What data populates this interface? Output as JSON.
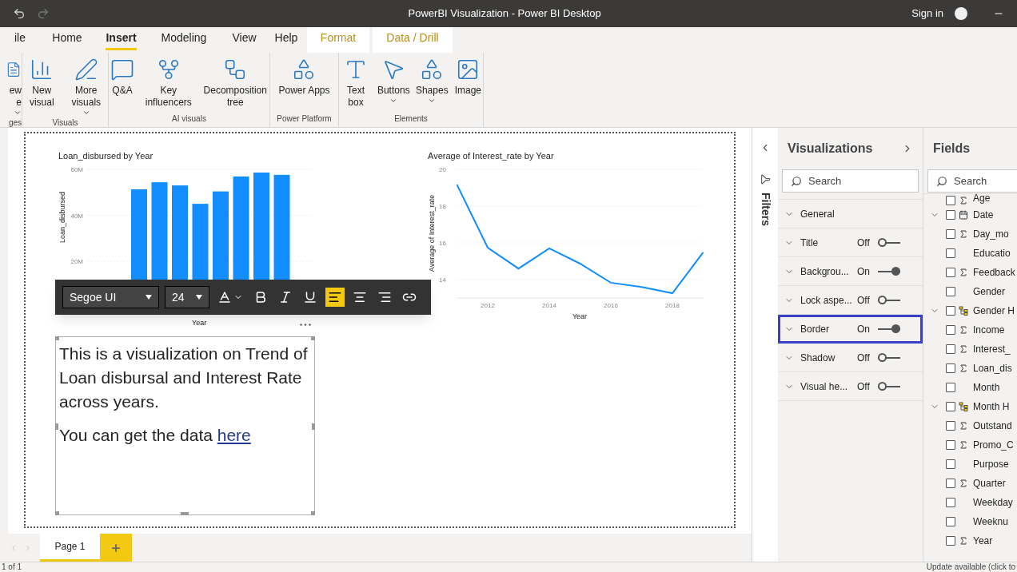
{
  "window": {
    "title": "PowerBI Visualization - Power BI Desktop",
    "sign_in": "Sign in"
  },
  "ribbon_tabs": [
    {
      "label": "ile",
      "kind": "normal",
      "selected": false
    },
    {
      "label": "Home",
      "kind": "normal",
      "selected": false
    },
    {
      "label": "Insert",
      "kind": "normal",
      "selected": true
    },
    {
      "label": "Modeling",
      "kind": "normal",
      "selected": false
    },
    {
      "label": "View",
      "kind": "normal",
      "selected": false
    },
    {
      "label": "Help",
      "kind": "normal",
      "selected": false
    },
    {
      "label": "Format",
      "kind": "contextual",
      "selected": false
    },
    {
      "label": "Data / Drill",
      "kind": "contextual",
      "selected": false
    }
  ],
  "ribbon_groups": [
    {
      "label": "ges",
      "items": [
        {
          "label": "ew e",
          "dropdown": true
        }
      ]
    },
    {
      "label": "Visuals",
      "items": [
        {
          "label": "New visual",
          "dropdown": false
        },
        {
          "label": "More visuals",
          "dropdown": true
        }
      ]
    },
    {
      "label": "AI visuals",
      "items": [
        {
          "label": "Q&A",
          "dropdown": false
        },
        {
          "label": "Key influencers",
          "dropdown": false
        },
        {
          "label": "Decomposition tree",
          "dropdown": false
        }
      ]
    },
    {
      "label": "Power Platform",
      "items": [
        {
          "label": "Power Apps",
          "dropdown": false
        }
      ]
    },
    {
      "label": "Elements",
      "items": [
        {
          "label": "Text box",
          "dropdown": false
        },
        {
          "label": "Buttons",
          "dropdown": true
        },
        {
          "label": "Shapes",
          "dropdown": true
        },
        {
          "label": "Image",
          "dropdown": false
        }
      ]
    }
  ],
  "bar_visual": {
    "x_axis_title": "Year",
    "chart_data": {
      "type": "bar",
      "title": "Loan_disbursed by Year",
      "ylabel": "Loan_disbursed",
      "categories": [
        null,
        null,
        null,
        null,
        null,
        null,
        null,
        null,
        null,
        null,
        null
      ],
      "grid": true,
      "ylim": [
        0,
        60
      ],
      "series": [
        {
          "color": "#118dff",
          "values": [
            null,
            null,
            51.3,
            54.4,
            53.0,
            45.0,
            50.4,
            56.9,
            58.6,
            57.6,
            null
          ]
        }
      ],
      "yticks": [
        {
          "value": 20,
          "label": "20M"
        },
        {
          "value": 40,
          "label": "40M"
        },
        {
          "value": 60,
          "label": "60M"
        }
      ]
    }
  },
  "line_visual": {
    "chart_data": {
      "type": "line",
      "title": "Average of Interest_rate by Year",
      "xlabel": "Year",
      "ylabel": "Average of Interest_rate",
      "x": [
        2011,
        2012,
        2013,
        2014,
        2015,
        2016,
        2017,
        2018,
        2019
      ],
      "grid": true,
      "series": [
        {
          "color": "#118dff",
          "values": [
            19.17,
            15.74,
            14.6,
            15.7,
            14.87,
            13.83,
            13.6,
            13.26,
            15.48
          ]
        }
      ],
      "xlim": [
        2011,
        2019
      ],
      "ylim": [
        13,
        20
      ],
      "yticks": [
        14,
        16,
        18,
        20
      ],
      "xticks": [
        2012,
        2014,
        2016,
        2018
      ]
    }
  },
  "text_toolbar": {
    "font": "Segoe UI",
    "size": "24",
    "buttons": [
      {
        "kind": "font-color",
        "selected": false
      },
      {
        "kind": "bold",
        "selected": false
      },
      {
        "kind": "italic",
        "selected": false
      },
      {
        "kind": "underline",
        "selected": false
      },
      {
        "kind": "align-left",
        "selected": true
      },
      {
        "kind": "align-center",
        "selected": false
      },
      {
        "kind": "align-right",
        "selected": false
      },
      {
        "kind": "link",
        "selected": false
      }
    ]
  },
  "text_box": {
    "paragraphs": [
      {
        "text": "This is a visualization on Trend of Loan disbursal and Interest Rate across years."
      },
      {
        "text": "You can get the data",
        "link": "here"
      }
    ]
  },
  "filters_pane": {
    "title": "Filters"
  },
  "visualizations_pane": {
    "title": "Visualizations",
    "search": {
      "placeholder": "Search"
    },
    "sections": [
      {
        "label": "General",
        "kind": "plain",
        "highlighted": false
      },
      {
        "label": "Title",
        "kind": "toggle",
        "status": "Off",
        "on": false,
        "highlighted": false
      },
      {
        "label": "Backgrou...",
        "kind": "toggle",
        "status": "On",
        "on": true,
        "highlighted": false
      },
      {
        "label": "Lock aspe...",
        "kind": "toggle",
        "status": "Off",
        "on": false,
        "highlighted": false
      },
      {
        "label": "Border",
        "kind": "toggle",
        "status": "On",
        "on": true,
        "highlighted": true
      },
      {
        "label": "Shadow",
        "kind": "toggle",
        "status": "Off",
        "on": false,
        "highlighted": false
      },
      {
        "label": "Visual he...",
        "kind": "toggle",
        "status": "Off",
        "on": false,
        "highlighted": false
      }
    ]
  },
  "fields_pane": {
    "title": "Fields",
    "search": {
      "placeholder": "Search"
    },
    "items": [
      {
        "name": "Age",
        "kind": "numeric",
        "expanded": false,
        "checked": false
      },
      {
        "name": "Date",
        "kind": "date",
        "expanded": true,
        "checked": false
      },
      {
        "name": "Day_mo",
        "kind": "numeric",
        "expanded": false,
        "checked": false
      },
      {
        "name": "Educatio",
        "kind": "text",
        "expanded": false,
        "checked": false
      },
      {
        "name": "Feedback",
        "kind": "numeric",
        "expanded": false,
        "checked": false
      },
      {
        "name": "Gender",
        "kind": "text",
        "expanded": false,
        "checked": false
      },
      {
        "name": "Gender H",
        "kind": "hierarchy",
        "expanded": true,
        "checked": false
      },
      {
        "name": "Income",
        "kind": "numeric",
        "expanded": false,
        "checked": false
      },
      {
        "name": "Interest_",
        "kind": "numeric",
        "expanded": false,
        "checked": false
      },
      {
        "name": "Loan_dis",
        "kind": "numeric",
        "expanded": false,
        "checked": false
      },
      {
        "name": "Month",
        "kind": "text",
        "expanded": false,
        "checked": false
      },
      {
        "name": "Month H",
        "kind": "hierarchy",
        "expanded": true,
        "checked": false
      },
      {
        "name": "Outstand",
        "kind": "numeric",
        "expanded": false,
        "checked": false
      },
      {
        "name": "Promo_C",
        "kind": "numeric",
        "expanded": false,
        "checked": false
      },
      {
        "name": "Purpose",
        "kind": "text",
        "expanded": false,
        "checked": false
      },
      {
        "name": "Quarter",
        "kind": "numeric",
        "expanded": false,
        "checked": false
      },
      {
        "name": "Weekday",
        "kind": "text",
        "expanded": false,
        "checked": false
      },
      {
        "name": "Weeknu",
        "kind": "text",
        "expanded": false,
        "checked": false
      },
      {
        "name": "Year",
        "kind": "numeric",
        "expanded": false,
        "checked": false
      }
    ]
  },
  "page_tabs": [
    {
      "label": "Page 1",
      "selected": true
    }
  ],
  "status_bar": {
    "left": "1 of 1",
    "right": "Update available (click to"
  }
}
